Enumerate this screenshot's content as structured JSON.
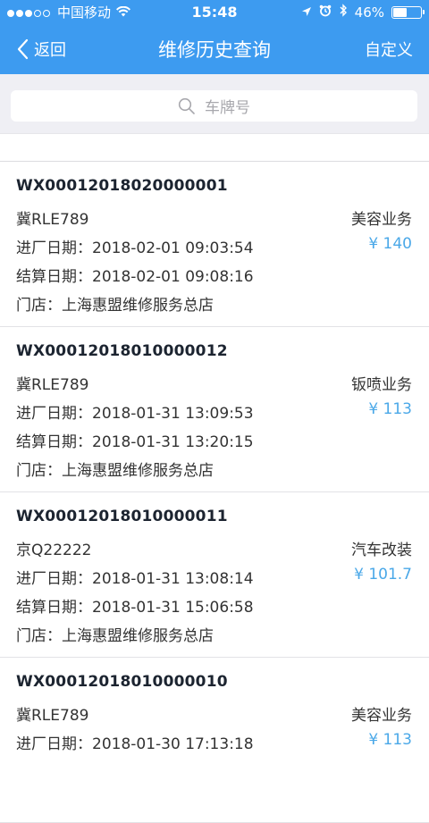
{
  "status_bar": {
    "carrier": "中国移动",
    "time": "15:48",
    "battery": "46%",
    "battery_level": 0.46
  },
  "nav": {
    "back_label": "返回",
    "title": "维修历史查询",
    "right_label": "自定义"
  },
  "search": {
    "placeholder": "车牌号"
  },
  "labels": {
    "in_date": "进厂日期：",
    "settle_date": "结算日期：",
    "store": "门店："
  },
  "records": [
    {
      "order_no": "WX00012018020000001",
      "plate": "冀RLE789",
      "service_type": "美容业务",
      "price": "¥ 140",
      "in_date": "2018-02-01 09:03:54",
      "settle_date": "2018-02-01 09:08:16",
      "store": "上海惠盟维修服务总店"
    },
    {
      "order_no": "WX00012018010000012",
      "plate": "冀RLE789",
      "service_type": "钣喷业务",
      "price": "¥ 113",
      "in_date": "2018-01-31 13:09:53",
      "settle_date": "2018-01-31 13:20:15",
      "store": "上海惠盟维修服务总店"
    },
    {
      "order_no": "WX00012018010000011",
      "plate": "京Q22222",
      "service_type": "汽车改装",
      "price": "¥ 101.7",
      "in_date": "2018-01-31 13:08:14",
      "settle_date": "2018-01-31 15:06:58",
      "store": "上海惠盟维修服务总店"
    },
    {
      "order_no": "WX00012018010000010",
      "plate": "冀RLE789",
      "service_type": "美容业务",
      "price": "¥ 113",
      "in_date": "2018-01-30 17:13:18",
      "settle_date": "",
      "store": ""
    }
  ],
  "colors": {
    "primary": "#3d9bf0",
    "price": "#4aa8e8",
    "search_bg": "#efeff4"
  }
}
